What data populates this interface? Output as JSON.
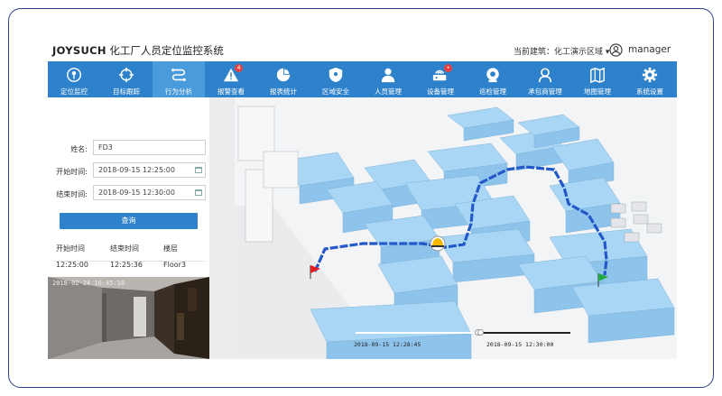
{
  "header": {
    "brand": "JOYSUCH",
    "system_title": "化工厂人员定位监控系统",
    "building_label": "当前建筑：",
    "building_value": "化工演示区域",
    "user": "manager"
  },
  "nav": {
    "items": [
      {
        "label": "定位监控",
        "icon": "location-icon"
      },
      {
        "label": "目标跟踪",
        "icon": "target-icon"
      },
      {
        "label": "行为分析",
        "icon": "path-icon",
        "active": true
      },
      {
        "label": "报警查看",
        "icon": "alarm-icon",
        "badge": "4"
      },
      {
        "label": "报表统计",
        "icon": "pie-chart-icon"
      },
      {
        "label": "区域安全",
        "icon": "shield-icon"
      },
      {
        "label": "人员管理",
        "icon": "person-icon"
      },
      {
        "label": "设备管理",
        "icon": "device-icon",
        "badge": "•"
      },
      {
        "label": "巡检管理",
        "icon": "patrol-icon"
      },
      {
        "label": "承包商管理",
        "icon": "contractor-icon"
      },
      {
        "label": "地图管理",
        "icon": "map-icon"
      },
      {
        "label": "系统设置",
        "icon": "gear-icon"
      }
    ]
  },
  "query": {
    "name_label": "姓名:",
    "name_value": "FD3",
    "start_label": "开始时间:",
    "start_value": "2018-09-15 12:25:00",
    "end_label": "结束时间:",
    "end_value": "2018-09-15 12:30:00",
    "button": "查询"
  },
  "results": {
    "headers": [
      "开始时间",
      "结束时间",
      "楼层"
    ],
    "rows": [
      [
        "12:25:00",
        "12:25:36",
        "Floor3"
      ]
    ]
  },
  "video": {
    "timestamp": "2018-02-24 16:45:10"
  },
  "timeline": {
    "start": "2018-09-15 12:28:45",
    "end": "2018-09-15 12:30:00",
    "progress": 0.57
  },
  "colors": {
    "nav_bg": "#2e82cc",
    "nav_active": "#4a9bdc",
    "path": "#2358c8",
    "building": "#9ccdf0",
    "start_flag": "#e02222",
    "end_flag": "#22aa44"
  }
}
